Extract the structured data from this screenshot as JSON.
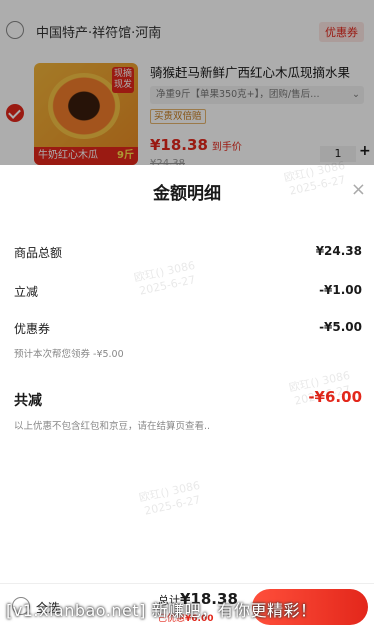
{
  "cart": {
    "store_name": "中国特产·祥符馆·河南",
    "store_badge": "优惠券",
    "product": {
      "title": "骑猴赶马新鲜广西红心木瓜现摘水果",
      "spec": "净重9斤【单果350克+】，团购/售后…",
      "badge": "买贵双倍赔",
      "thumb_tag": "现摘现发",
      "thumb_label": "牛奶红心木瓜",
      "thumb_weight": "9斤",
      "price": "¥18.38",
      "price_suffix": "到手价",
      "orig_price": "¥24.38",
      "qty": "1",
      "plus": "+"
    }
  },
  "sheet": {
    "title": "金额明细",
    "close": "×",
    "rows": [
      {
        "label": "商品总额",
        "value": "¥24.38"
      },
      {
        "label": "立减",
        "value": "-¥1.00"
      },
      {
        "label": "优惠券",
        "value": "-¥5.00"
      }
    ],
    "coupon_note": "预计本次帮您领券 -¥5.00",
    "total_label": "共减",
    "total_value": "-¥6.00",
    "footnote": "以上优惠不包含红包和京豆，请在结算页查看..",
    "watermark_line1": "欧玒() 3086",
    "watermark_line2": "2025-6-27"
  },
  "bottombar": {
    "select_all": "全选",
    "total_prefix": "总计",
    "total_value": "¥18.38",
    "discount_prefix": "已优惠",
    "discount_value": "¥6.00"
  },
  "banner": "[v1.xianbao.net] 新赚吧，有你更精彩！",
  "colors": {
    "accent": "#e3271b",
    "badge_bg": "#fde6e4",
    "muted": "#888888"
  }
}
